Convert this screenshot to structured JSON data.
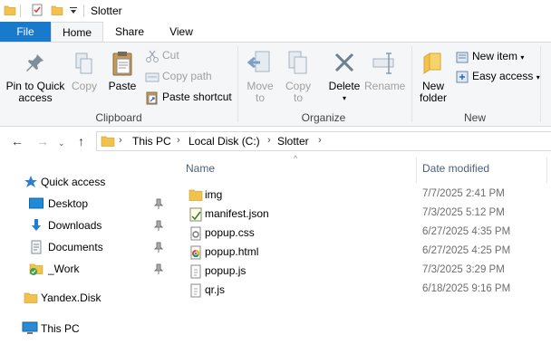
{
  "window": {
    "title": "Slotter"
  },
  "ribbon_tabs": {
    "file": "File",
    "home": "Home",
    "share": "Share",
    "view": "View"
  },
  "ribbon": {
    "clipboard": {
      "pin_line1": "Pin to Quick",
      "pin_line2": "access",
      "copy": "Copy",
      "paste": "Paste",
      "cut": "Cut",
      "copy_path": "Copy path",
      "paste_shortcut": "Paste shortcut",
      "group": "Clipboard"
    },
    "organize": {
      "move_line1": "Move",
      "move_line2": "to",
      "copy_line1": "Copy",
      "copy_line2": "to",
      "delete": "Delete",
      "rename": "Rename",
      "group": "Organize"
    },
    "new": {
      "folder_line1": "New",
      "folder_line2": "folder",
      "new_item": "New item",
      "easy_access": "Easy access",
      "group": "New"
    }
  },
  "address": {
    "crumbs": [
      "This PC",
      "Local Disk (C:)",
      "Slotter"
    ]
  },
  "nav": {
    "quick_access": "Quick access",
    "desktop": "Desktop",
    "downloads": "Downloads",
    "documents": "Documents",
    "work": "_Work",
    "yandex": "Yandex.Disk",
    "this_pc": "This PC"
  },
  "columns": {
    "name": "Name",
    "date": "Date modified"
  },
  "files": [
    {
      "name": "img",
      "date": "7/7/2025 2:41 PM",
      "icon": "folder-icon"
    },
    {
      "name": "manifest.json",
      "date": "7/3/2025 5:12 PM",
      "icon": "json-file-icon"
    },
    {
      "name": "popup.css",
      "date": "6/27/2025 4:35 PM",
      "icon": "css-file-icon"
    },
    {
      "name": "popup.html",
      "date": "6/27/2025 4:25 PM",
      "icon": "chrome-html-icon"
    },
    {
      "name": "popup.js",
      "date": "7/3/2025 3:29 PM",
      "icon": "js-file-icon"
    },
    {
      "name": "qr.js",
      "date": "6/18/2025 9:16 PM",
      "icon": "js-file-icon"
    }
  ],
  "colors": {
    "accent": "#1979ca",
    "folder": "#f2c24f",
    "ribbon_bg": "#f5f6f7"
  }
}
